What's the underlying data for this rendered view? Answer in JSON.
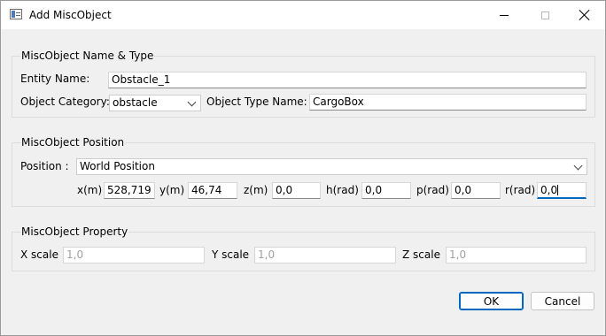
{
  "window": {
    "title": "Add MiscObject"
  },
  "name_type": {
    "title": "MiscObject Name & Type",
    "entity_label": "Entity Name:",
    "entity_value": "Obstacle_1",
    "category_label": "Object Category:",
    "category_value": "obstacle",
    "type_label": "Object Type Name:",
    "type_value": "CargoBox"
  },
  "position": {
    "title": "MiscObject Position",
    "position_label": "Position :",
    "position_value": "World Position",
    "x_label": "x(m)",
    "x_value": "528,719",
    "y_label": "y(m)",
    "y_value": "46,74",
    "z_label": "z(m)",
    "z_value": "0,0",
    "h_label": "h(rad)",
    "h_value": "0,0",
    "p_label": "p(rad)",
    "p_value": "0,0",
    "r_label": "r(rad)",
    "r_value": "0,0"
  },
  "property": {
    "title": "MiscObject Property",
    "xs_label": "X scale",
    "xs_value": "1,0",
    "ys_label": "Y scale",
    "ys_value": "1,0",
    "zs_label": "Z scale",
    "zs_value": "1,0"
  },
  "buttons": {
    "ok": "OK",
    "cancel": "Cancel"
  },
  "colors": {
    "accent": "#0067c0"
  },
  "icons": [
    "app-icon",
    "minimize-icon",
    "maximize-icon",
    "close-icon",
    "chevron-down-icon"
  ]
}
